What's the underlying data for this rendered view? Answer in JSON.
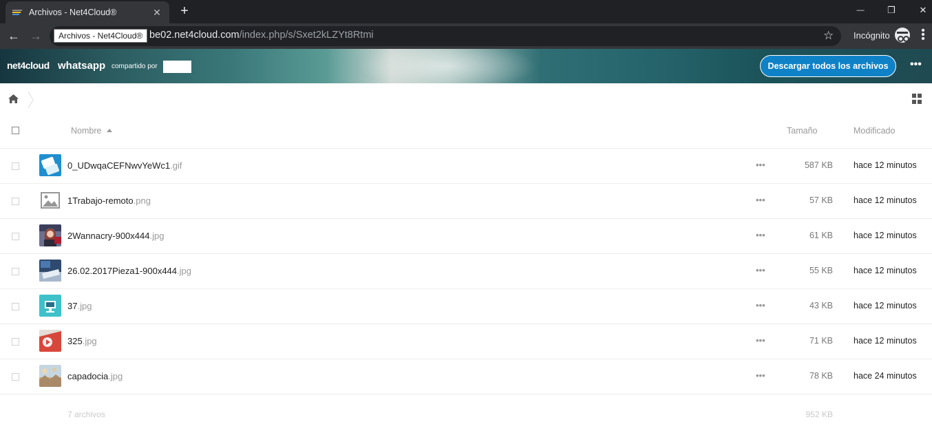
{
  "browser": {
    "tab_title": "Archivos - Net4Cloud®",
    "tooltip": "Archivos - Net4Cloud®",
    "url_host": "be02.net4cloud.com",
    "url_path": "/index.php/s/Sxet2kLZYt8Rtmi",
    "incognito_label": "Incógnito",
    "new_tab_glyph": "+",
    "close_glyph": "✕",
    "minimize_glyph": "—",
    "restore_glyph": "❐",
    "window_close_glyph": "✕"
  },
  "header": {
    "logo_text": "net4cloud",
    "app_name": "whatsapp",
    "shared_by": "compartido por",
    "download_all_label": "Descargar todos los archivos",
    "more_glyph": "•••"
  },
  "table": {
    "col_name": "Nombre",
    "col_size": "Tamaño",
    "col_modified": "Modificado",
    "rows": [
      {
        "base": "0_UDwqaCEFNwvYeWc1",
        "ext": ".gif",
        "size": "587 KB",
        "modified": "hace 12 minutos",
        "thumb": "thumb-blue-app"
      },
      {
        "base": "1Trabajo-remoto",
        "ext": ".png",
        "size": "57 KB",
        "modified": "hace 12 minutos",
        "thumb": "image-placeholder-icon"
      },
      {
        "base": "2Wannacry-900x444",
        "ext": ".jpg",
        "size": "61 KB",
        "modified": "hace 12 minutos",
        "thumb": "thumb-person"
      },
      {
        "base": "26.02.2017Pieza1-900x444",
        "ext": ".jpg",
        "size": "55 KB",
        "modified": "hace 12 minutos",
        "thumb": "thumb-laptop"
      },
      {
        "base": "37",
        "ext": ".jpg",
        "size": "43 KB",
        "modified": "hace 12 minutos",
        "thumb": "thumb-teal-screen"
      },
      {
        "base": "325",
        "ext": ".jpg",
        "size": "71 KB",
        "modified": "hace 12 minutos",
        "thumb": "thumb-red-play"
      },
      {
        "base": "capadocia",
        "ext": ".jpg",
        "size": "78 KB",
        "modified": "hace 24 minutos",
        "thumb": "thumb-landscape"
      }
    ],
    "row_actions_glyph": "•••",
    "summary_count": "7 archivos",
    "summary_size": "952 KB"
  },
  "colors": {
    "chrome_dark": "#202124",
    "chrome_toolbar": "#35363a",
    "accent_blue": "#0f82c7"
  }
}
